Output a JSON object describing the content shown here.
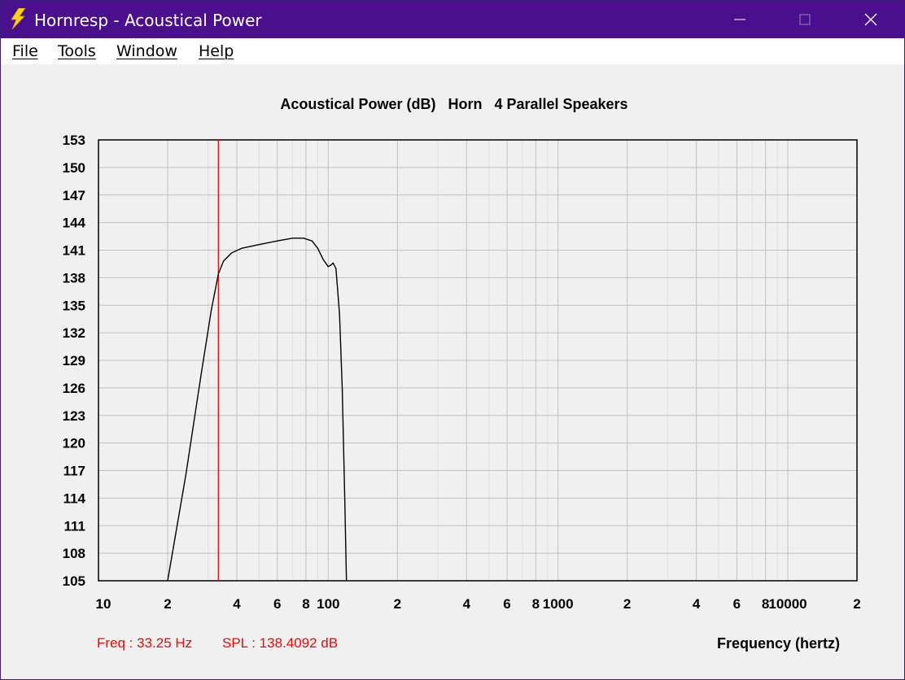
{
  "window": {
    "title": "Hornresp - Acoustical Power",
    "icon": "lightning-bolt-icon",
    "controls": [
      "minimize-icon",
      "maximize-icon",
      "close-icon"
    ]
  },
  "menu": {
    "items": [
      {
        "label": "File",
        "name": "menu-file"
      },
      {
        "label": "Tools",
        "name": "menu-tools"
      },
      {
        "label": "Window",
        "name": "menu-window"
      },
      {
        "label": "Help",
        "name": "menu-help"
      }
    ]
  },
  "status": {
    "freq": "Freq : 33.25 Hz",
    "spl": "SPL : 138.4092 dB"
  },
  "colors": {
    "titlebar": "#4a0f8c",
    "cursor": "#ff0000",
    "curve": "#000000",
    "grid": "#c8c8c8"
  },
  "chart_data": {
    "type": "line",
    "title": "Acoustical Power (dB)   Horn   4 Parallel Speakers",
    "xlabel": "Frequency (hertz)",
    "ylabel": "",
    "xscale": "log",
    "xlim": [
      10,
      20000
    ],
    "ylim": [
      105,
      153
    ],
    "yticks": [
      153,
      150,
      147,
      144,
      141,
      138,
      135,
      132,
      129,
      126,
      123,
      120,
      117,
      114,
      111,
      108,
      105
    ],
    "xtick_labels": [
      {
        "value": 10,
        "label": "10"
      },
      {
        "value": 20,
        "label": "2"
      },
      {
        "value": 40,
        "label": "4"
      },
      {
        "value": 60,
        "label": "6"
      },
      {
        "value": 80,
        "label": "8"
      },
      {
        "value": 100,
        "label": "100"
      },
      {
        "value": 200,
        "label": "2"
      },
      {
        "value": 400,
        "label": "4"
      },
      {
        "value": 600,
        "label": "6"
      },
      {
        "value": 800,
        "label": "8"
      },
      {
        "value": 1000,
        "label": "1000"
      },
      {
        "value": 2000,
        "label": "2"
      },
      {
        "value": 4000,
        "label": "4"
      },
      {
        "value": 6000,
        "label": "6"
      },
      {
        "value": 8000,
        "label": "8"
      },
      {
        "value": 10000,
        "label": "10000"
      },
      {
        "value": 20000,
        "label": "2"
      }
    ],
    "grid": true,
    "cursor_frequency": 33.25,
    "series": [
      {
        "x": [
          20,
          24,
          28,
          31,
          33.25,
          35,
          38,
          42,
          50,
          60,
          70,
          78,
          85,
          90,
          95,
          100,
          103,
          105,
          108,
          112,
          115,
          118,
          120
        ],
        "y": [
          105,
          116.5,
          127.5,
          134.5,
          138.4,
          139.8,
          140.7,
          141.2,
          141.6,
          142.0,
          142.3,
          142.3,
          142.0,
          141.2,
          140.0,
          139.2,
          139.4,
          139.6,
          139.0,
          134.0,
          126.0,
          114.0,
          105
        ]
      }
    ]
  }
}
